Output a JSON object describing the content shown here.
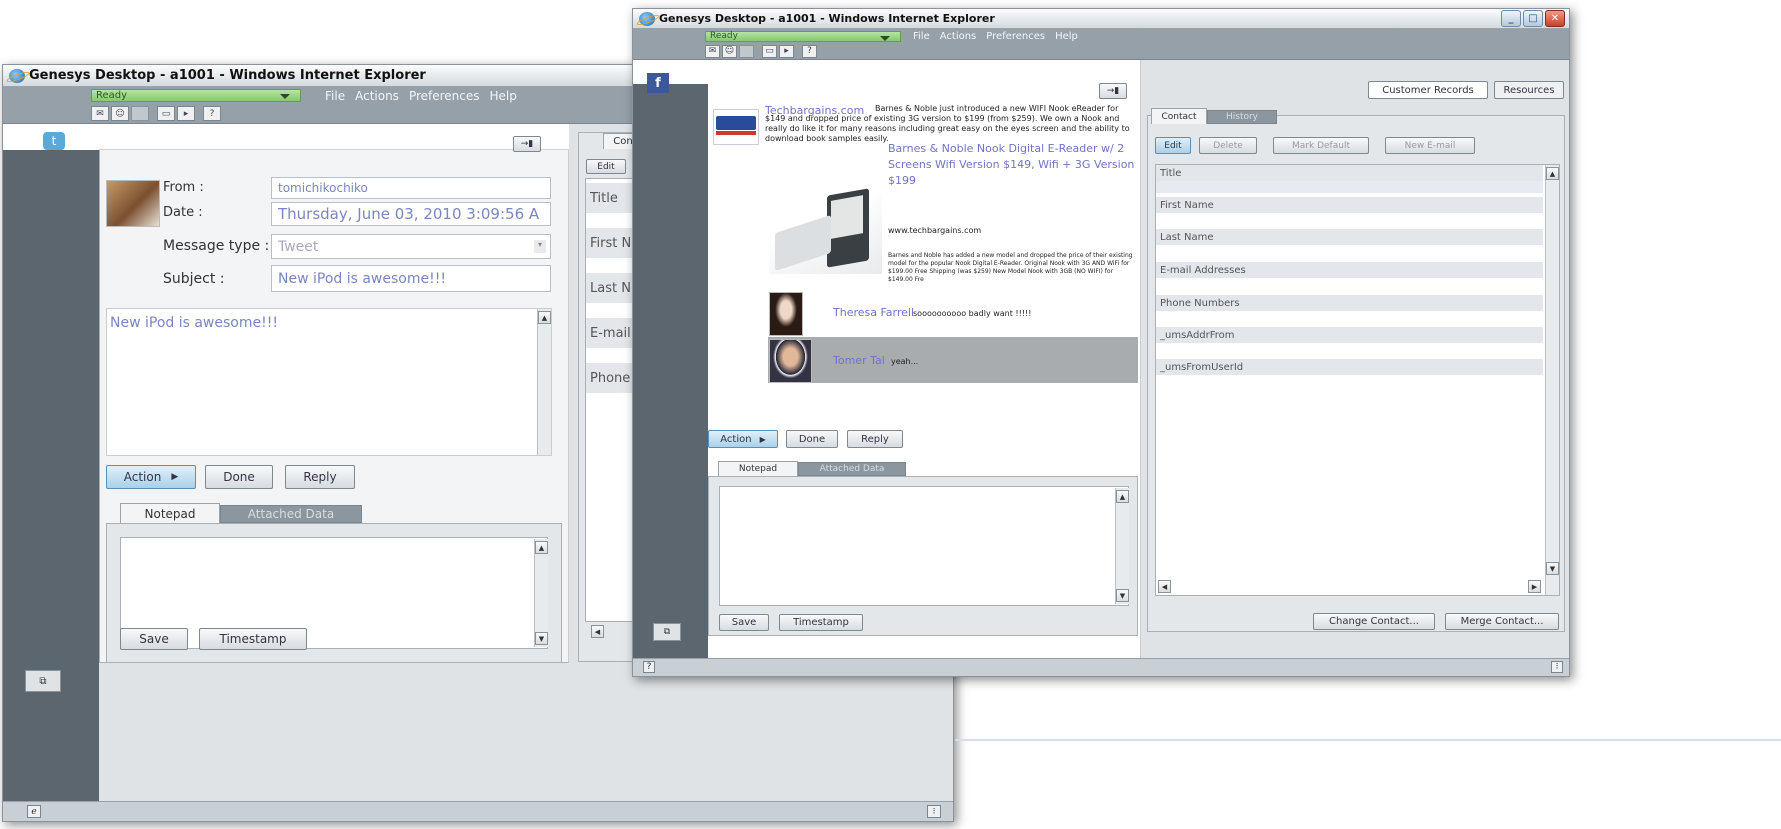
{
  "window_left": {
    "title": "Genesys Desktop - a1001 - Windows Internet Explorer",
    "status": "Ready",
    "menu": [
      "File",
      "Actions",
      "Preferences",
      "Help"
    ],
    "logo_icon": "twitter-bird-icon",
    "from_label": "From :",
    "from_value": "tomichikochiko",
    "date_label": "Date :",
    "date_value": "Thursday, June 03, 2010 3:09:56 A",
    "msgtype_label": "Message type :",
    "msgtype_value": "Tweet",
    "subject_label": "Subject :",
    "subject_value": "New iPod is awesome!!!",
    "body_text": "New iPod is awesome!!!",
    "action_label": "Action",
    "done_label": "Done",
    "reply_label": "Reply",
    "tab_notepad": "Notepad",
    "tab_attached": "Attached Data",
    "save_label": "Save",
    "timestamp_label": "Timestamp",
    "right_tab_partial": "Con",
    "edit_partial": "Edit",
    "contact_rows": [
      "Title",
      "First N",
      "Last N",
      "E-mail",
      "Phone"
    ]
  },
  "window_right": {
    "title": "Genesys Desktop - a1001 - Windows Internet Explorer",
    "status": "Ready",
    "menu": [
      "File",
      "Actions",
      "Preferences",
      "Help"
    ],
    "logo_icon": "facebook-icon",
    "post": {
      "source": "Techbargains.com",
      "text": "Barnes & Noble just introduced a new WIFI Nook eReader for $149 and dropped price of existing 3G version to $199 (from $259). We own a Nook and really do like it for many reasons including great easy on the eyes screen and the ability to download book samples easily.",
      "link_title": "Barnes & Noble Nook Digital E-Reader w/ 2 Screens Wifi Version $149, Wifi + 3G Version $199",
      "link_url": "www.techbargains.com",
      "link_desc": "Barnes and Noble has added a new model and dropped the price of their existing model for the popular Nook Digital E-Reader. Original Nook with 3G AND WiFi for $199.00 Free Shipping (was $259) New Model Nook with 3GB (NO WIFI) for $149.00 Fre"
    },
    "comments": [
      {
        "name": "Theresa Farrell",
        "text": "soooooooooo badly want !!!!!"
      },
      {
        "name": "Tomer Tal",
        "text": "yeah..."
      }
    ],
    "action_label": "Action",
    "done_label": "Done",
    "reply_label": "Reply",
    "tab_notepad": "Notepad",
    "tab_attached": "Attached Data",
    "save_label": "Save",
    "timestamp_label": "Timestamp",
    "top_tabs": [
      "Customer Records",
      "Resources"
    ],
    "sub_tabs": [
      "Contact",
      "History"
    ],
    "record_buttons": [
      "Edit",
      "Delete",
      "Mark Default",
      "New E-mail"
    ],
    "record_fields": [
      "Title",
      "First Name",
      "Last Name",
      "E-mail Addresses",
      "Phone Numbers",
      "_umsAddrFrom",
      "_umsFromUserId"
    ],
    "change_contact_label": "Change Contact...",
    "merge_contact_label": "Merge Contact..."
  }
}
